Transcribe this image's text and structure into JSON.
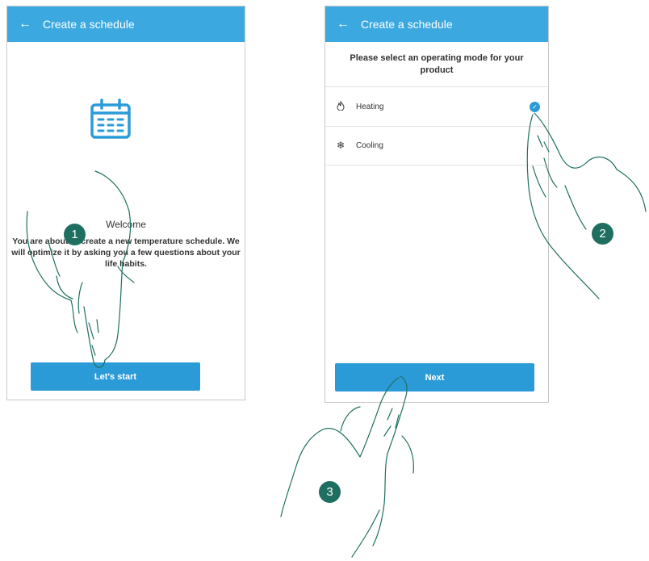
{
  "screen1": {
    "back_icon": "←",
    "title": "Create a schedule",
    "welcome_title": "Welcome",
    "welcome_body": "You are about to create a new temperature schedule. We will optimize it by asking you a few questions about your life habits.",
    "start_button": "Let's start"
  },
  "screen2": {
    "back_icon": "←",
    "title": "Create a schedule",
    "prompt": "Please select an operating mode for your product",
    "modes": [
      {
        "label": "Heating",
        "icon": "flame-icon",
        "glyph": "🜂",
        "selected": true
      },
      {
        "label": "Cooling",
        "icon": "snowflake-icon",
        "glyph": "❄",
        "selected": false
      }
    ],
    "check_glyph": "✓",
    "next_button": "Next"
  },
  "steps": [
    "1",
    "2",
    "3"
  ],
  "colors": {
    "appbar": "#3ba9e0",
    "button": "#2b9bd8",
    "badge": "#1f6f60"
  }
}
